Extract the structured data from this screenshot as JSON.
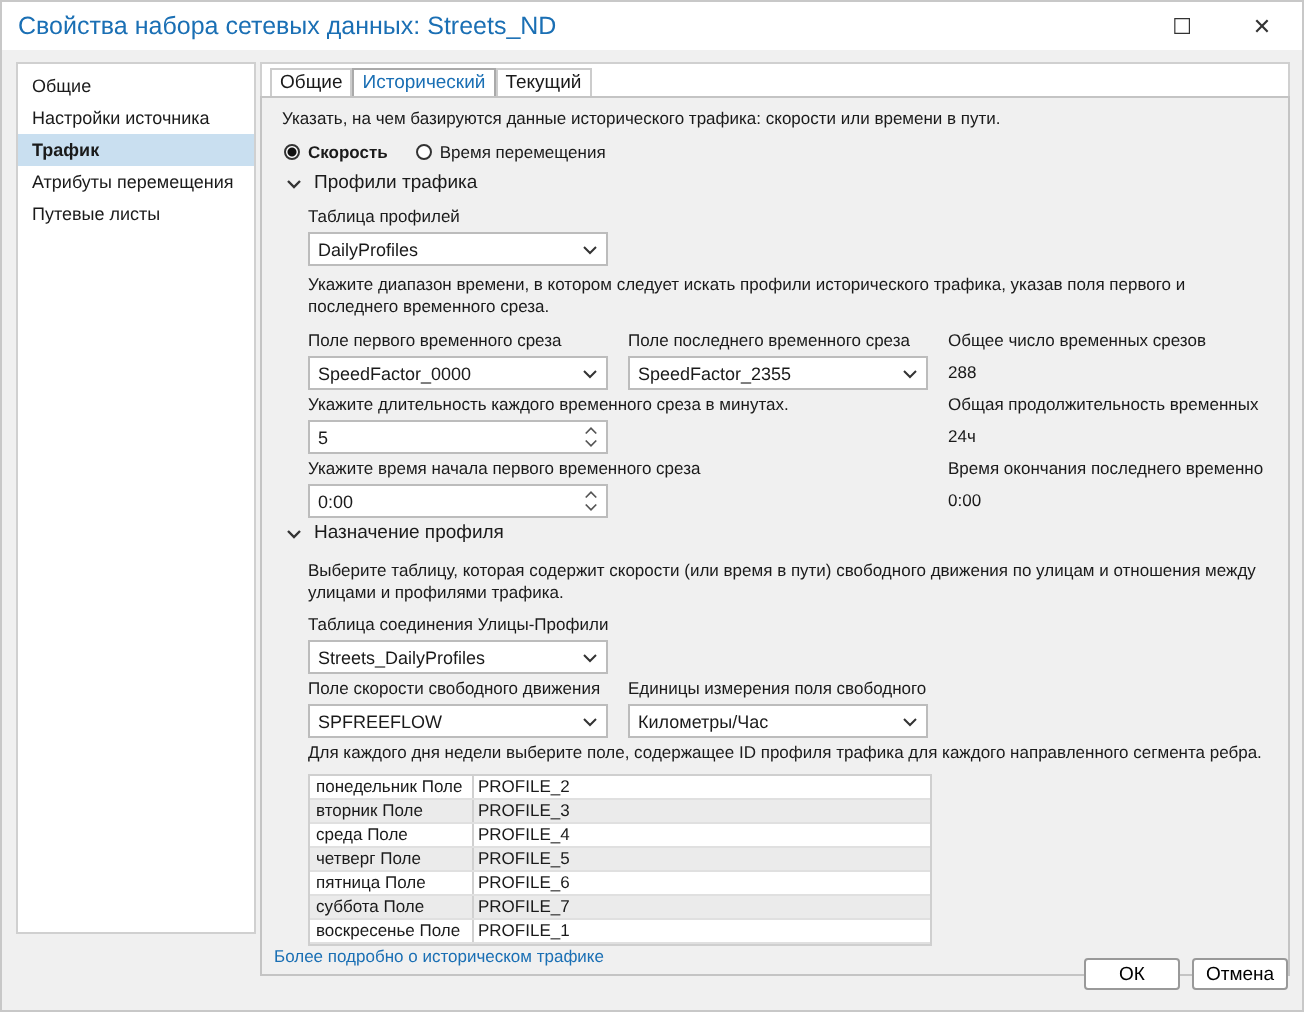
{
  "window": {
    "title": "Свойства набора сетевых данных: Streets_ND",
    "maximize": "☐",
    "close": "✕"
  },
  "sidebar": {
    "items": [
      {
        "label": "Общие",
        "selected": false
      },
      {
        "label": "Настройки источника",
        "selected": false
      },
      {
        "label": "Трафик",
        "selected": true
      },
      {
        "label": "Атрибуты перемещения",
        "selected": false
      },
      {
        "label": "Путевые листы",
        "selected": false
      }
    ]
  },
  "tabs": [
    {
      "label": "Общие",
      "selected": false
    },
    {
      "label": "Исторический",
      "selected": true
    },
    {
      "label": "Текущий",
      "selected": false
    }
  ],
  "intro": "Указать, на чем базируются данные исторического трафика: скорости или времени в пути.",
  "radios": [
    {
      "label": "Скорость",
      "selected": true
    },
    {
      "label": "Время перемещения",
      "selected": false
    }
  ],
  "profiles_section": {
    "title": "Профили трафика",
    "expanded": true,
    "table_label": "Таблица профилей",
    "table_value": "DailyProfiles",
    "range_hint": "Укажите диапазон времени, в котором следует искать профили исторического трафика, указав поля первого и последнего временного среза.",
    "first_label": "Поле первого временного среза",
    "first_value": "SpeedFactor_0000",
    "last_label": "Поле последнего временного среза",
    "last_value": "SpeedFactor_2355",
    "count_label": "Общее число временных срезов",
    "count_value": "288",
    "duration_label": "Укажите длительность каждого временного среза в минутах.",
    "duration_value": "5",
    "total_label": "Общая продолжительность временных",
    "total_value": "24ч",
    "start_label": "Укажите время начала первого временного среза",
    "start_value": "0:00",
    "end_label": "Время окончания последнего временно",
    "end_value": "0:00"
  },
  "assignment_section": {
    "title": "Назначение профиля",
    "expanded": true,
    "hint": "Выберите таблицу, которая содержит скорости (или время в пути) свободного движения по улицам и отношения между улицами и профилями трафика.",
    "join_label": "Таблица соединения Улицы-Профили",
    "join_value": "Streets_DailyProfiles",
    "freeflow_label": "Поле скорости свободного движения",
    "freeflow_value": "SPFREEFLOW",
    "units_label": "Единицы измерения поля свободного",
    "units_value": "Километры/Час",
    "days_hint": "Для каждого дня недели выберите поле, содержащее ID профиля трафика для каждого направленного сегмента ребра.",
    "days": [
      {
        "day": "понедельник Поле",
        "field": "PROFILE_2"
      },
      {
        "day": "вторник Поле",
        "field": "PROFILE_3"
      },
      {
        "day": "среда Поле",
        "field": "PROFILE_4"
      },
      {
        "day": "четверг Поле",
        "field": "PROFILE_5"
      },
      {
        "day": "пятница Поле",
        "field": "PROFILE_6"
      },
      {
        "day": "суббота Поле",
        "field": "PROFILE_7"
      },
      {
        "day": "воскресенье Поле",
        "field": "PROFILE_1"
      }
    ]
  },
  "link": "Более подробно о историческом трафике",
  "buttons": [
    "ОК",
    "Отмена"
  ]
}
